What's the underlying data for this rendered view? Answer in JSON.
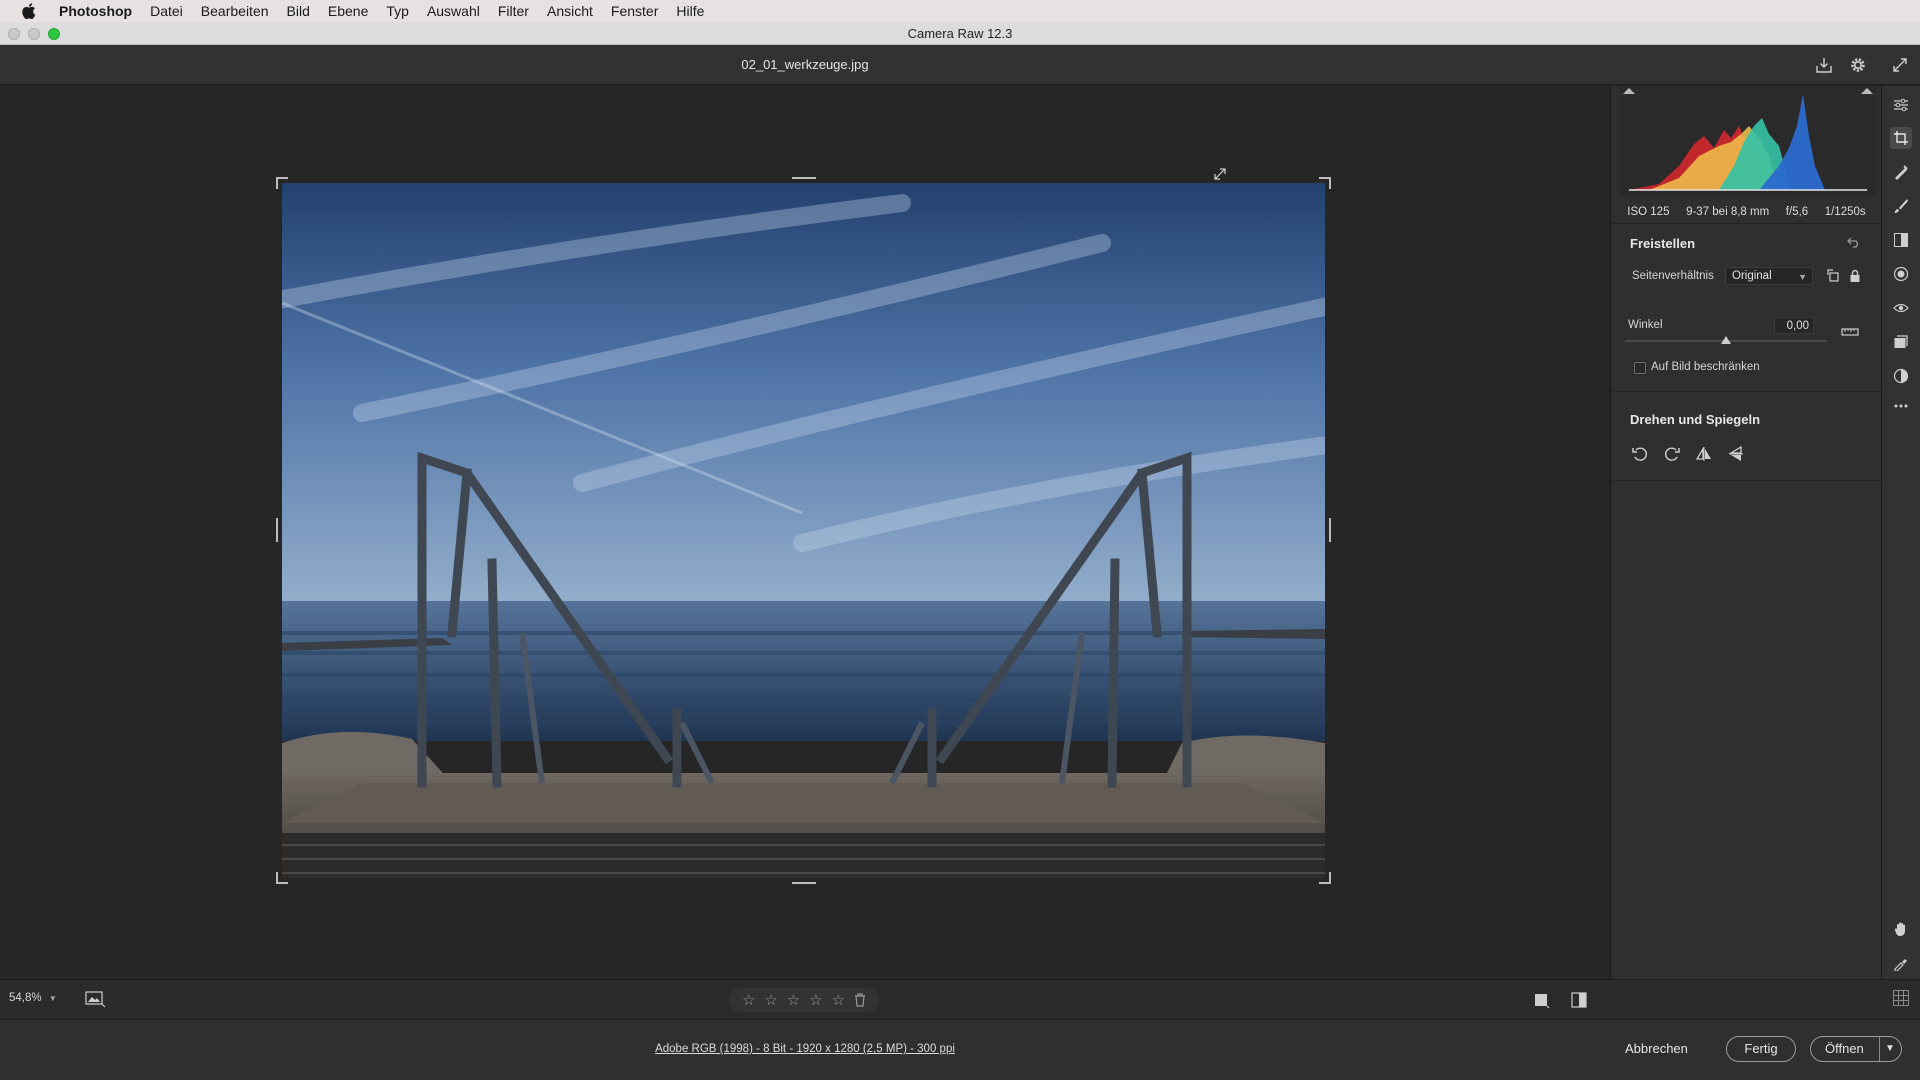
{
  "menubar": {
    "app": "Photoshop",
    "items": [
      "Datei",
      "Bearbeiten",
      "Bild",
      "Ebene",
      "Typ",
      "Auswahl",
      "Filter",
      "Ansicht",
      "Fenster",
      "Hilfe"
    ]
  },
  "window": {
    "title": "Camera Raw 12.3"
  },
  "file": {
    "name": "02_01_werkzeuge.jpg"
  },
  "exif": {
    "iso": "ISO 125",
    "lens": "9-37 bei 8,8 mm",
    "aperture": "f/5,6",
    "shutter": "1/1250s"
  },
  "crop_panel": {
    "title": "Freistellen",
    "aspect_label": "Seitenverhältnis",
    "aspect_value": "Original",
    "angle_label": "Winkel",
    "angle_value": "0,00",
    "angle_level": 0.5,
    "constrain_label": "Auf Bild beschränken",
    "constrain_checked": false
  },
  "rotate_panel": {
    "title": "Drehen und Spiegeln"
  },
  "status": {
    "zoom": "54,8%",
    "workflow": "Adobe RGB (1998) - 8 Bit - 1920 x 1280 (2,5 MP) - 300 ppi",
    "rating": 0
  },
  "buttons": {
    "cancel": "Abbrechen",
    "done": "Fertig",
    "open": "Öffnen"
  },
  "colors": {
    "accent_green": "#2ac840",
    "traffic_close": "#5f5f5f",
    "panel_bg": "#2f2f2f"
  }
}
